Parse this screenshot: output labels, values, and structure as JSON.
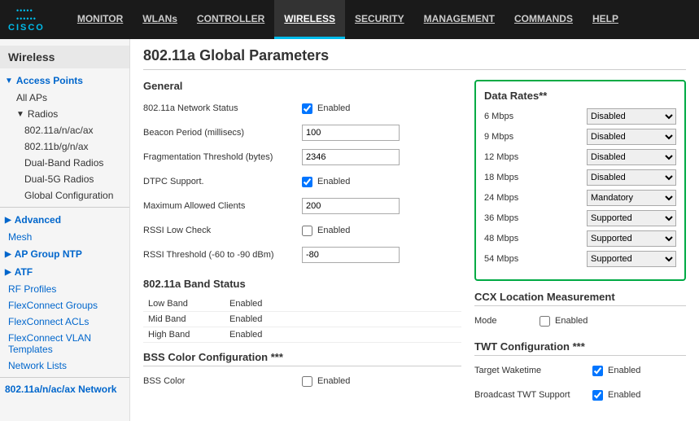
{
  "nav": {
    "logo_dots": ".....",
    "logo_name": "CISCO",
    "items": [
      {
        "id": "monitor",
        "label": "MONITOR"
      },
      {
        "id": "wlans",
        "label": "WLANs"
      },
      {
        "id": "controller",
        "label": "CONTROLLER"
      },
      {
        "id": "wireless",
        "label": "WIRELESS",
        "active": true
      },
      {
        "id": "security",
        "label": "SECURITY"
      },
      {
        "id": "management",
        "label": "MANAGEMENT"
      },
      {
        "id": "commands",
        "label": "COMMANDS"
      },
      {
        "id": "help",
        "label": "HELP"
      }
    ]
  },
  "sidebar": {
    "title": "Wireless",
    "items": [
      {
        "id": "access-points",
        "label": "Access Points",
        "level": "parent",
        "icon": "▼"
      },
      {
        "id": "all-aps",
        "label": "All APs",
        "level": "sub"
      },
      {
        "id": "radios",
        "label": "Radios",
        "level": "sub",
        "icon": "▼"
      },
      {
        "id": "80211a",
        "label": "802.11a/n/ac/ax",
        "level": "sub2"
      },
      {
        "id": "80211b",
        "label": "802.11b/g/n/ax",
        "level": "sub2"
      },
      {
        "id": "dual-band",
        "label": "Dual-Band Radios",
        "level": "sub2"
      },
      {
        "id": "dual-5g",
        "label": "Dual-5G Radios",
        "level": "sub2"
      },
      {
        "id": "global-config",
        "label": "Global Configuration",
        "level": "sub2"
      },
      {
        "id": "advanced",
        "label": "Advanced",
        "level": "section"
      },
      {
        "id": "mesh",
        "label": "Mesh",
        "level": "plain"
      },
      {
        "id": "ap-group-ntp",
        "label": "AP Group NTP",
        "level": "section"
      },
      {
        "id": "atf",
        "label": "ATF",
        "level": "section"
      },
      {
        "id": "rf-profiles",
        "label": "RF Profiles",
        "level": "plain"
      },
      {
        "id": "flexconnect-groups",
        "label": "FlexConnect Groups",
        "level": "plain"
      },
      {
        "id": "flexconnect-acls",
        "label": "FlexConnect ACLs",
        "level": "plain"
      },
      {
        "id": "flexconnect-vlan",
        "label": "FlexConnect VLAN Templates",
        "level": "plain"
      },
      {
        "id": "network-lists",
        "label": "Network Lists",
        "level": "plain"
      },
      {
        "id": "80211a-network",
        "label": "802.11a/n/ac/ax Network",
        "level": "active"
      }
    ]
  },
  "page": {
    "title": "802.11a Global Parameters"
  },
  "general": {
    "section_label": "General",
    "fields": [
      {
        "id": "network-status",
        "label": "802.11a Network Status",
        "type": "checkbox",
        "checked": true,
        "value": "Enabled"
      },
      {
        "id": "beacon-period",
        "label": "Beacon Period (millisecs)",
        "type": "input",
        "value": "100"
      },
      {
        "id": "frag-threshold",
        "label": "Fragmentation Threshold (bytes)",
        "type": "input",
        "value": "2346"
      },
      {
        "id": "dtpc",
        "label": "DTPC Support.",
        "type": "checkbox",
        "checked": true,
        "value": "Enabled"
      },
      {
        "id": "max-clients",
        "label": "Maximum Allowed Clients",
        "type": "input",
        "value": "200"
      },
      {
        "id": "rssi-low",
        "label": "RSSI Low Check",
        "type": "checkbox",
        "checked": false,
        "value": "Enabled"
      },
      {
        "id": "rssi-threshold",
        "label": "RSSI Threshold (-60 to -90 dBm)",
        "type": "input",
        "value": "-80"
      }
    ]
  },
  "band_status": {
    "section_label": "802.11a Band Status",
    "rows": [
      {
        "id": "low-band",
        "label": "Low Band",
        "value": "Enabled"
      },
      {
        "id": "mid-band",
        "label": "Mid Band",
        "value": "Enabled"
      },
      {
        "id": "high-band",
        "label": "High Band",
        "value": "Enabled"
      }
    ]
  },
  "bss_color": {
    "section_label": "BSS Color Configuration ***",
    "fields": [
      {
        "id": "bss-color",
        "label": "BSS Color",
        "type": "checkbox",
        "checked": false,
        "value": "Enabled"
      }
    ]
  },
  "data_rates": {
    "title": "Data Rates**",
    "rates": [
      {
        "id": "6mbps",
        "label": "6 Mbps",
        "value": "Disabled"
      },
      {
        "id": "9mbps",
        "label": "9 Mbps",
        "value": "Disabled"
      },
      {
        "id": "12mbps",
        "label": "12 Mbps",
        "value": "Disabled"
      },
      {
        "id": "18mbps",
        "label": "18 Mbps",
        "value": "Disabled"
      },
      {
        "id": "24mbps",
        "label": "24 Mbps",
        "value": "Mandatory"
      },
      {
        "id": "36mbps",
        "label": "36 Mbps",
        "value": "Supported"
      },
      {
        "id": "48mbps",
        "label": "48 Mbps",
        "value": "Supported"
      },
      {
        "id": "54mbps",
        "label": "54 Mbps",
        "value": "Supported"
      }
    ],
    "options": [
      "Disabled",
      "Mandatory",
      "Supported"
    ]
  },
  "ccx": {
    "title": "CCX Location Measurement",
    "fields": [
      {
        "id": "ccx-mode",
        "label": "Mode",
        "type": "checkbox",
        "checked": false,
        "value": "Enabled"
      }
    ]
  },
  "twt": {
    "title": "TWT Configuration ***",
    "fields": [
      {
        "id": "target-waketime",
        "label": "Target Waketime",
        "type": "checkbox",
        "checked": true,
        "value": "Enabled"
      },
      {
        "id": "broadcast-twt",
        "label": "Broadcast TWT Support",
        "type": "checkbox",
        "checked": true,
        "value": "Enabled"
      }
    ]
  }
}
